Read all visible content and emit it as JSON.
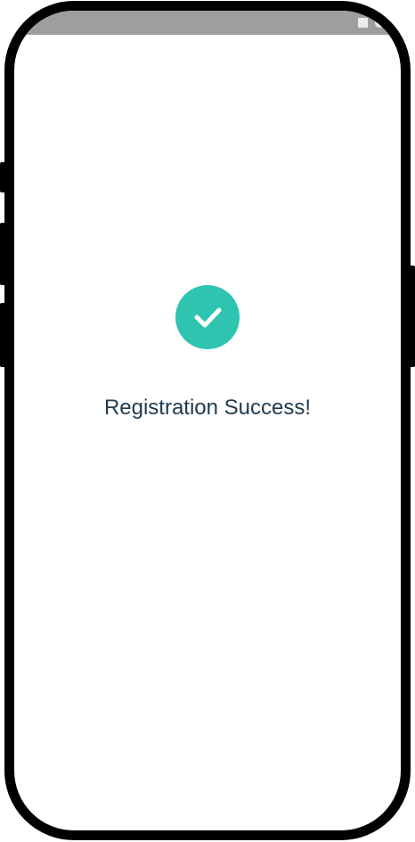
{
  "status_bar": {
    "icons": [
      "square-icon",
      "circle-icon",
      "triangle-icon"
    ],
    "background": "#9e9e9e"
  },
  "main": {
    "check_icon": "check-circle-icon",
    "check_color": "#2ec4b0",
    "title": "Registration Success!"
  }
}
